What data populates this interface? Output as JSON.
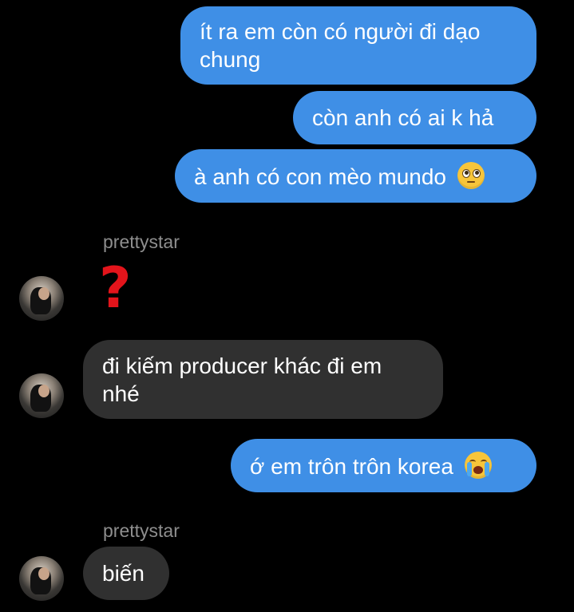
{
  "conversation": {
    "messages": [
      {
        "direction": "sent",
        "lines": [
          "ít ra em còn có người đi dạo",
          "chung"
        ]
      },
      {
        "direction": "sent",
        "text": "còn anh có ai k hả"
      },
      {
        "direction": "sent",
        "text": "à anh có con mèo mundo",
        "emoji": "face-with-rolling-eyes"
      },
      {
        "direction": "received",
        "sender": "prettystar",
        "text": "❓"
      },
      {
        "direction": "received",
        "lines": [
          "đi kiếm producer khác đi em",
          "nhé"
        ]
      },
      {
        "direction": "sent",
        "text": "ớ em trôn trôn korea",
        "emoji": "loudly-crying-face"
      },
      {
        "direction": "received",
        "sender": "prettystar",
        "text": "biến"
      }
    ]
  },
  "colors": {
    "background": "#000000",
    "sent_bubble": "#3f8fe6",
    "received_bubble": "#303030",
    "sender_name": "#8e8e8e",
    "question_mark": "#e3141b"
  }
}
